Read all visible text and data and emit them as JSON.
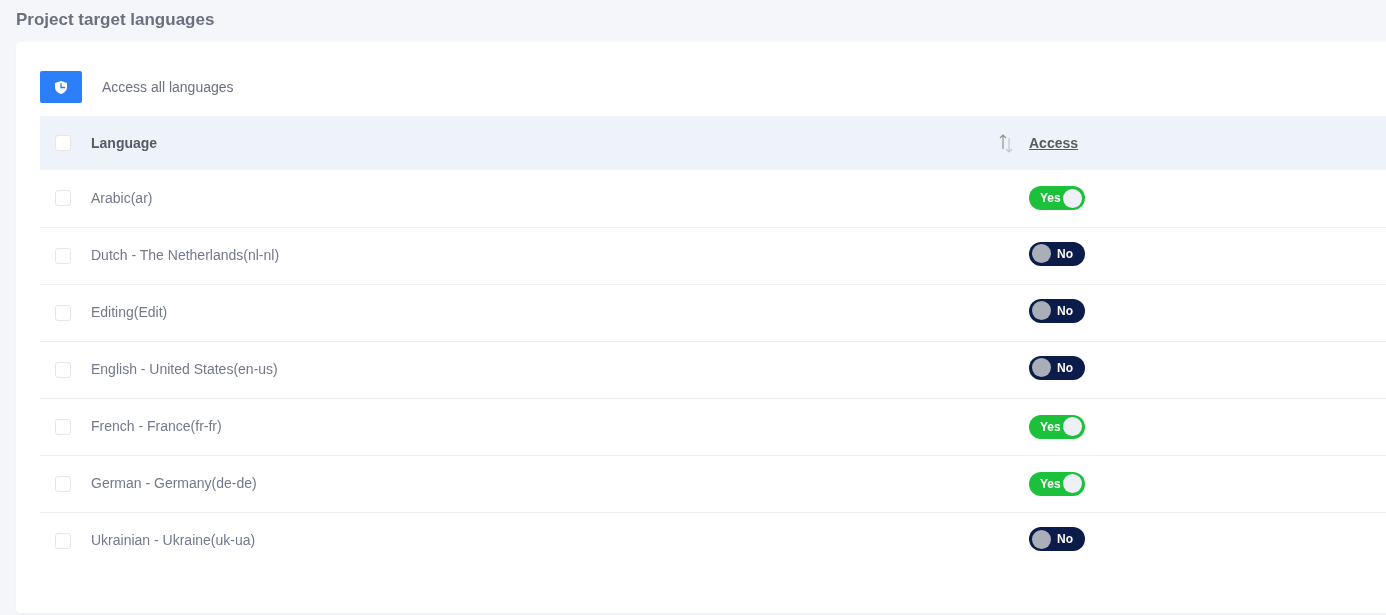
{
  "page": {
    "title": "Project target languages"
  },
  "toolbar": {
    "access_all_label": "Access all languages"
  },
  "table": {
    "select_all_checked": false,
    "columns": [
      {
        "label": "Language",
        "sortable": true
      },
      {
        "label": "Access",
        "sortable": false
      }
    ],
    "rows": [
      {
        "language": "Arabic(ar)",
        "checked": false,
        "access": {
          "on": true,
          "label": "Yes"
        }
      },
      {
        "language": "Dutch - The Netherlands(nl-nl)",
        "checked": false,
        "access": {
          "on": false,
          "label": "No"
        }
      },
      {
        "language": "Editing(Edit)",
        "checked": false,
        "access": {
          "on": false,
          "label": "No"
        }
      },
      {
        "language": "English - United States(en-us)",
        "checked": false,
        "access": {
          "on": false,
          "label": "No"
        }
      },
      {
        "language": "French - France(fr-fr)",
        "checked": false,
        "access": {
          "on": true,
          "label": "Yes"
        }
      },
      {
        "language": "German - Germany(de-de)",
        "checked": false,
        "access": {
          "on": true,
          "label": "Yes"
        }
      },
      {
        "language": "Ukrainian - Ukraine(uk-ua)",
        "checked": false,
        "access": {
          "on": false,
          "label": "No"
        }
      }
    ]
  }
}
